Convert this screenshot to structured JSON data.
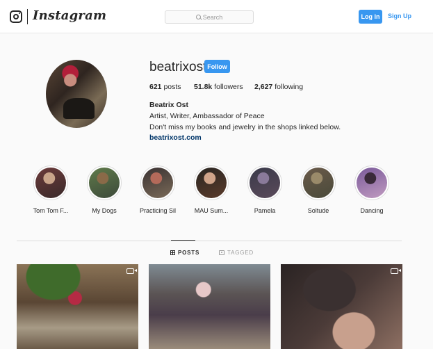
{
  "header": {
    "brand": "Instagram",
    "search_placeholder": "Search",
    "login_label": "Log In",
    "signup_label": "Sign Up"
  },
  "profile": {
    "username": "beatrixost",
    "follow_label": "Follow",
    "posts_count": "621",
    "posts_label": "posts",
    "followers_count": "51.8k",
    "followers_label": "followers",
    "following_count": "2,627",
    "following_label": "following",
    "full_name": "Beatrix Ost",
    "bio_line1": "Artist, Writer, Ambassador of Peace",
    "bio_line2": "Don't miss my books and jewelry in the shops linked below.",
    "website": "beatrixost.com"
  },
  "highlights": [
    {
      "label": "Tom Tom F...",
      "colors": [
        "#6b3a3a",
        "#c9a48a",
        "#3a2a2a"
      ]
    },
    {
      "label": "My Dogs",
      "colors": [
        "#5f7a4a",
        "#8a6a48",
        "#3d4a3a"
      ]
    },
    {
      "label": "Practicing Sil",
      "colors": [
        "#3a3232",
        "#b46a5a",
        "#7a6a58"
      ]
    },
    {
      "label": "MAU Sum...",
      "colors": [
        "#2a2622",
        "#d0a48a",
        "#5a3a2a"
      ]
    },
    {
      "label": "Pamela",
      "colors": [
        "#3a3a4a",
        "#8a7a9a",
        "#5a4a5a"
      ]
    },
    {
      "label": "Soltude",
      "colors": [
        "#6a5a4a",
        "#9a8a6a",
        "#4a4a3a"
      ]
    },
    {
      "label": "Dancing",
      "colors": [
        "#7a5a9a",
        "#3a2a3a",
        "#c09ac0"
      ]
    }
  ],
  "tabs": {
    "posts": "POSTS",
    "tagged": "TAGGED"
  },
  "colors": {
    "accent": "#3897f0",
    "link": "#003569",
    "text": "#262626",
    "muted": "#999999"
  }
}
